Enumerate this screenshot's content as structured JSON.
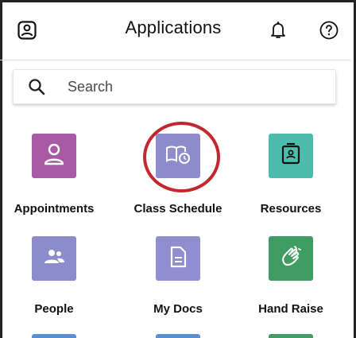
{
  "header": {
    "title": "Applications",
    "icons": {
      "left": "profile-icon",
      "bell": "bell-icon",
      "help": "help-icon"
    }
  },
  "search": {
    "placeholder": "Search"
  },
  "apps": [
    {
      "label": "Appointments",
      "icon": "person-icon",
      "color": "#a85aa4"
    },
    {
      "label": "Class Schedule",
      "icon": "book-clock-icon",
      "color": "#8f8ccd"
    },
    {
      "label": "Resources",
      "icon": "contact-card-icon",
      "color": "#4cbcae"
    },
    {
      "label": "People",
      "icon": "people-icon",
      "color": "#8c8bcb"
    },
    {
      "label": "My Docs",
      "icon": "document-icon",
      "color": "#908dd0"
    },
    {
      "label": "Hand Raise",
      "icon": "hand-icon",
      "color": "#3f9d63"
    }
  ],
  "colors": {
    "highlight": "#c4262e",
    "divider": "#e2e2e2"
  }
}
